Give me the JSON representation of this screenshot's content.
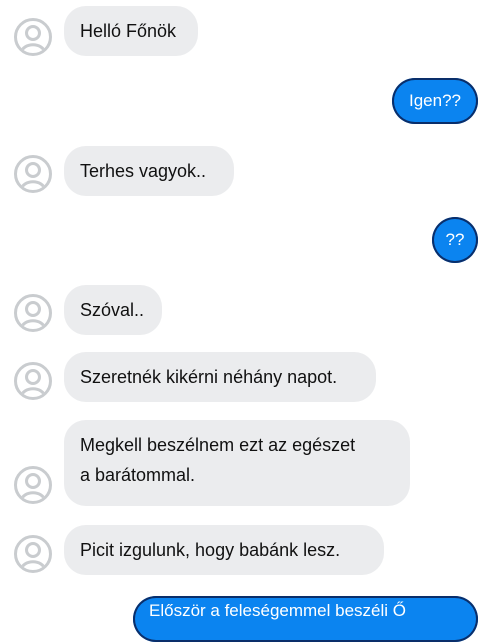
{
  "chat": {
    "messages": [
      {
        "side": "in",
        "text": "Helló Főnök"
      },
      {
        "side": "out",
        "text": "Igen??"
      },
      {
        "side": "in",
        "text": "Terhes vagyok.."
      },
      {
        "side": "out",
        "text": "??"
      },
      {
        "side": "in",
        "text": "Szóval.."
      },
      {
        "side": "in",
        "text": "Szeretnék kikérni néhány napot."
      },
      {
        "side": "in",
        "lines": [
          "Megkell beszélnem ezt az egészet",
          "a barátommal."
        ]
      },
      {
        "side": "in",
        "text": "Picit izgulunk, hogy babánk lesz."
      },
      {
        "side": "out",
        "text": "Először a feleségemmel beszéli Ő"
      }
    ]
  },
  "colors": {
    "incoming_bubble": "#ebecee",
    "outgoing_bubble": "#0b84f0",
    "avatar_outline": "#c9cccf"
  },
  "icons": {
    "avatar": "user-avatar-icon"
  }
}
